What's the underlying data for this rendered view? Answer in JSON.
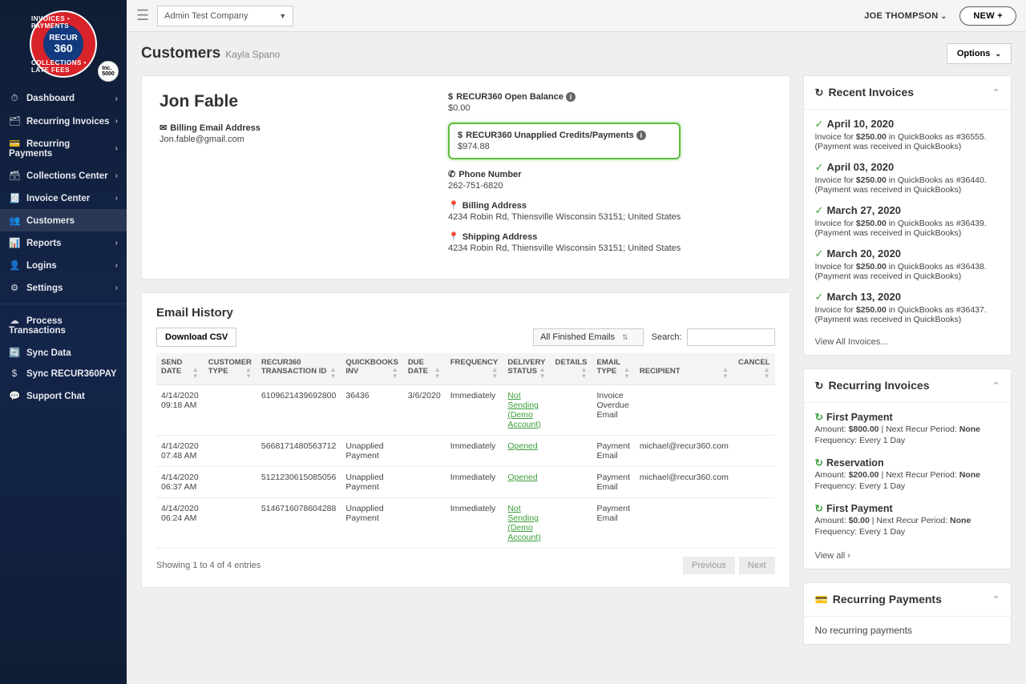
{
  "topbar": {
    "company": "Admin Test Company",
    "user": "JOE THOMPSON",
    "new_btn": "NEW +"
  },
  "page": {
    "title": "Customers",
    "subtitle": "Kayla Spano",
    "options_btn": "Options"
  },
  "sidebar": {
    "items": [
      {
        "icon": "⏱",
        "label": "Dashboard",
        "chev": true
      },
      {
        "icon": "🗂",
        "label": "Recurring Invoices",
        "chev": true
      },
      {
        "icon": "💳",
        "label": "Recurring Payments",
        "chev": true
      },
      {
        "icon": "🗃",
        "label": "Collections Center",
        "chev": true
      },
      {
        "icon": "🧾",
        "label": "Invoice Center",
        "chev": true
      },
      {
        "icon": "👥",
        "label": "Customers",
        "chev": false,
        "active": true
      },
      {
        "icon": "📊",
        "label": "Reports",
        "chev": true
      },
      {
        "icon": "👤",
        "label": "Logins",
        "chev": true
      },
      {
        "icon": "⚙",
        "label": "Settings",
        "chev": true
      }
    ],
    "secondary": [
      {
        "icon": "☁",
        "label": "Process Transactions"
      },
      {
        "icon": "🔄",
        "label": "Sync Data"
      },
      {
        "icon": "$",
        "label": "Sync RECUR360PAY"
      },
      {
        "icon": "💬",
        "label": "Support Chat"
      }
    ]
  },
  "customer": {
    "name": "Jon Fable",
    "email_label": "Billing Email Address",
    "email": "Jon.fable@gmail.com",
    "open_bal_label": "RECUR360 Open Balance",
    "open_bal": "$0.00",
    "unapplied_label": "RECUR360 Unapplied Credits/Payments",
    "unapplied": "$974.88",
    "phone_label": "Phone Number",
    "phone": "262-751-6820",
    "bill_addr_label": "Billing Address",
    "bill_addr": "4234 Robin Rd, Thiensville Wisconsin 53151; United States",
    "ship_addr_label": "Shipping Address",
    "ship_addr": "4234 Robin Rd, Thiensville Wisconsin 53151; United States"
  },
  "email_history": {
    "title": "Email History",
    "download": "Download CSV",
    "filter": "All Finished Emails",
    "search_label": "Search:",
    "columns": [
      "SEND DATE",
      "CUSTOMER TYPE",
      "RECUR360 TRANSACTION ID",
      "QUICKBOOKS INV",
      "DUE DATE",
      "FREQUENCY",
      "DELIVERY STATUS",
      "DETAILS",
      "EMAIL TYPE",
      "RECIPIENT",
      "CANCEL"
    ],
    "rows": [
      {
        "send": "4/14/2020 09:18 AM",
        "ctype": "",
        "txid": "6109621439692800",
        "qb": "36436",
        "due": "3/6/2020",
        "freq": "Immediately",
        "status": "Not Sending (Demo Account)",
        "details": "",
        "etype": "Invoice Overdue Email",
        "recip": ""
      },
      {
        "send": "4/14/2020 07:48 AM",
        "ctype": "",
        "txid": "5668171480563712",
        "qb": "Unapplied Payment",
        "due": "",
        "freq": "Immediately",
        "status": "Opened",
        "details": "",
        "etype": "Payment Email",
        "recip": "michael@recur360.com"
      },
      {
        "send": "4/14/2020 06:37 AM",
        "ctype": "",
        "txid": "5121230615085056",
        "qb": "Unapplied Payment",
        "due": "",
        "freq": "Immediately",
        "status": "Opened",
        "details": "",
        "etype": "Payment Email",
        "recip": "michael@recur360.com"
      },
      {
        "send": "4/14/2020 06:24 AM",
        "ctype": "",
        "txid": "5146716078604288",
        "qb": "Unapplied Payment",
        "due": "",
        "freq": "Immediately",
        "status": "Not Sending (Demo Account)",
        "details": "",
        "etype": "Payment Email",
        "recip": ""
      }
    ],
    "showing": "Showing 1 to 4 of 4 entries",
    "prev": "Previous",
    "next": "Next"
  },
  "recent_invoices": {
    "title": "Recent Invoices",
    "items": [
      {
        "date": "April 10, 2020",
        "amount": "$250.00",
        "num": "#36555."
      },
      {
        "date": "April 03, 2020",
        "amount": "$250.00",
        "num": "#36440."
      },
      {
        "date": "March 27, 2020",
        "amount": "$250.00",
        "num": "#36439."
      },
      {
        "date": "March 20, 2020",
        "amount": "$250.00",
        "num": "#36438."
      },
      {
        "date": "March 13, 2020",
        "amount": "$250.00",
        "num": "#36437."
      }
    ],
    "desc_prefix": "Invoice for ",
    "desc_mid": " in QuickBooks as ",
    "desc_suffix": " (Payment was received in QuickBooks)",
    "view_all": "View All Invoices..."
  },
  "recurring_invoices": {
    "title": "Recurring Invoices",
    "items": [
      {
        "name": "First Payment",
        "amount": "$800.00",
        "period": "None",
        "freq": "Frequency: Every 1 Day"
      },
      {
        "name": "Reservation",
        "amount": "$200.00",
        "period": "None",
        "freq": "Frequency: Every 1 Day"
      },
      {
        "name": "First Payment",
        "amount": "$0.00",
        "period": "None",
        "freq": "Frequency: Every 1 Day"
      }
    ],
    "amount_label": "Amount: ",
    "period_label": " | Next Recur Period: ",
    "view_all": "View all"
  },
  "recurring_payments": {
    "title": "Recurring Payments",
    "empty": "No recurring payments"
  }
}
